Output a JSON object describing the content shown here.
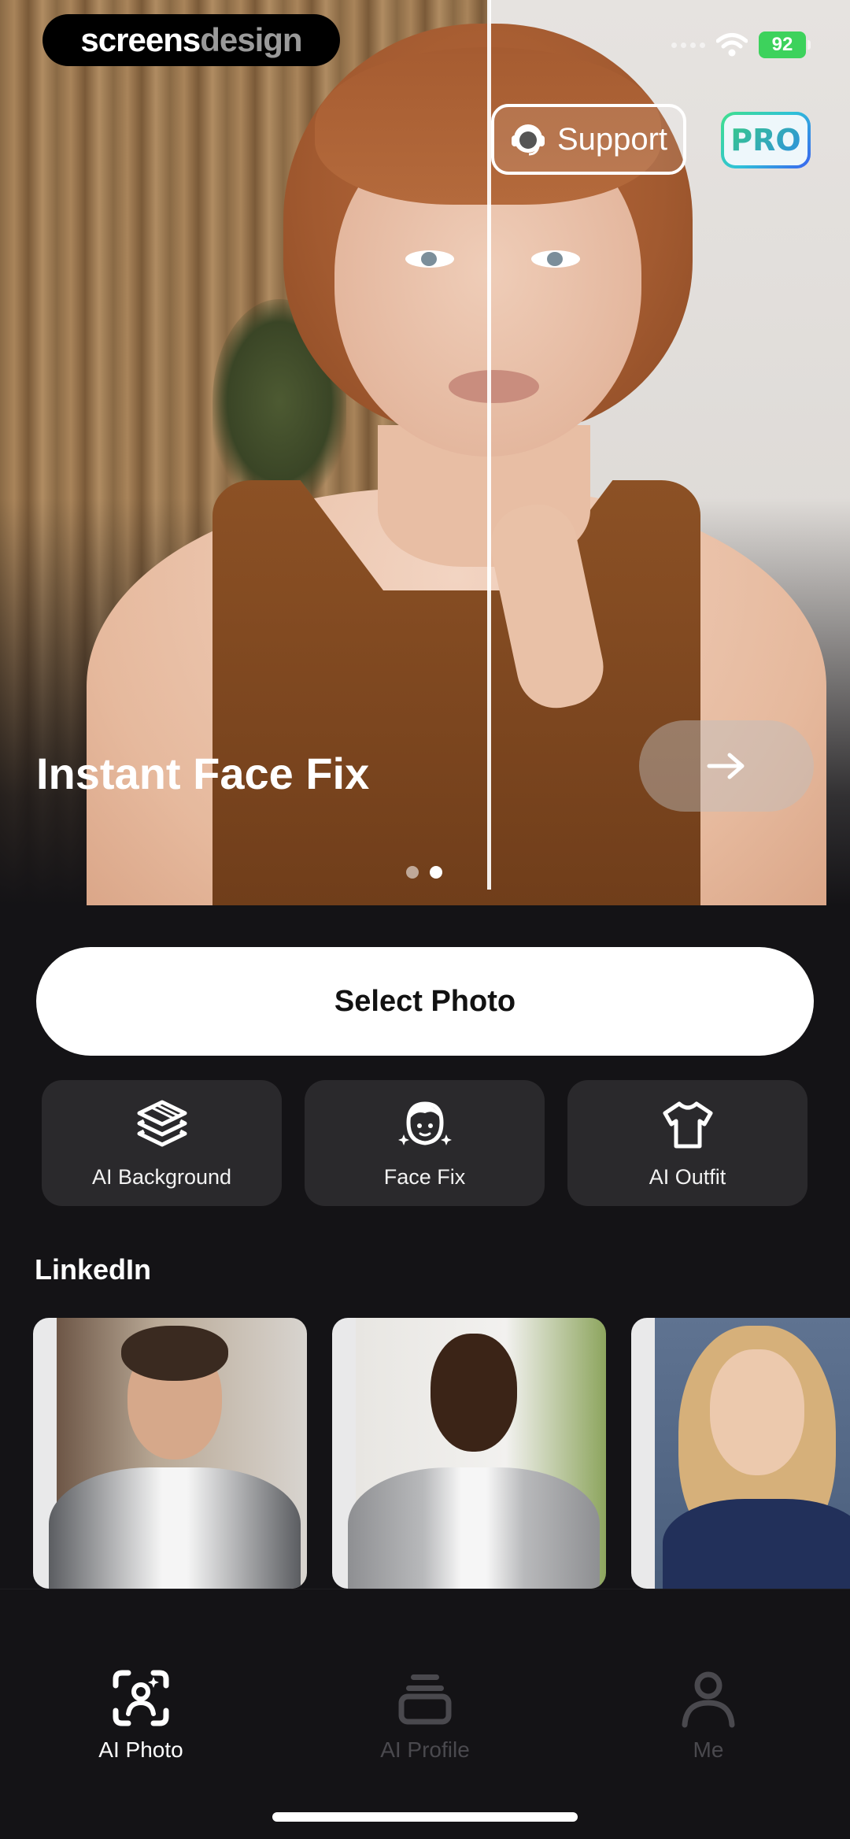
{
  "watermark": {
    "part1": "screens",
    "part2": "design"
  },
  "status_bar": {
    "battery": "92"
  },
  "header": {
    "support_label": "Support",
    "pro_label": "PRO"
  },
  "hero": {
    "title": "Instant Face Fix",
    "page_count": 2,
    "active_page": 2
  },
  "primary_action": {
    "label": "Select Photo"
  },
  "features": [
    {
      "label": "AI Background",
      "icon": "layers-icon"
    },
    {
      "label": "Face Fix",
      "icon": "face-sparkle-icon"
    },
    {
      "label": "AI Outfit",
      "icon": "tshirt-icon"
    }
  ],
  "linkedin": {
    "title": "LinkedIn"
  },
  "tabs": [
    {
      "label": "AI Photo",
      "icon": "face-scan-icon",
      "active": true
    },
    {
      "label": "AI Profile",
      "icon": "stack-icon",
      "active": false
    },
    {
      "label": "Me",
      "icon": "person-icon",
      "active": false
    }
  ],
  "colors": {
    "background": "#141316",
    "card": "#2a292c",
    "accent_pro": "#37c98a",
    "battery": "#3dd25c"
  }
}
